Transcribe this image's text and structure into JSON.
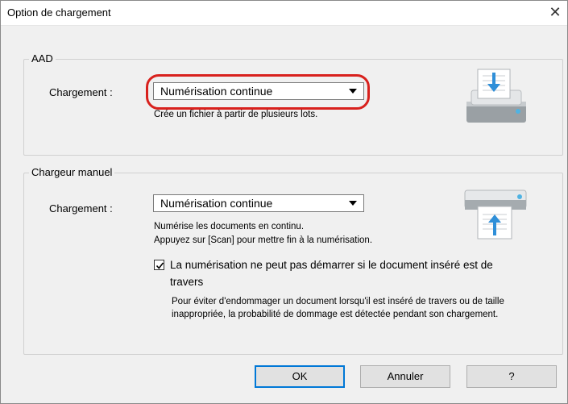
{
  "window": {
    "title": "Option de chargement",
    "close_glyph": "✕"
  },
  "aad": {
    "group_label": "AAD",
    "field_label": "Chargement :",
    "selected_value": "Numérisation continue",
    "description": "Crée un fichier à partir de plusieurs lots."
  },
  "manual": {
    "group_label": "Chargeur manuel",
    "field_label": "Chargement :",
    "selected_value": "Numérisation continue",
    "description_line1": "Numérise les documents en continu.",
    "description_line2": "Appuyez sur [Scan] pour mettre fin à la numérisation.",
    "checkbox_checked": true,
    "checkbox_label_line1": "La numérisation ne peut pas démarrer si le document inséré est de",
    "checkbox_label_line2": "travers",
    "note_line1": "Pour éviter d'endommager un document lorsqu'il est inséré de travers ou de taille",
    "note_line2": "inappropriée, la probabilité de dommage est détectée pendant son chargement."
  },
  "buttons": {
    "ok": "OK",
    "cancel": "Annuler",
    "help": "?"
  },
  "colors": {
    "highlight": "#d8211d",
    "accent": "#0078d7",
    "background": "#fce5c7"
  }
}
